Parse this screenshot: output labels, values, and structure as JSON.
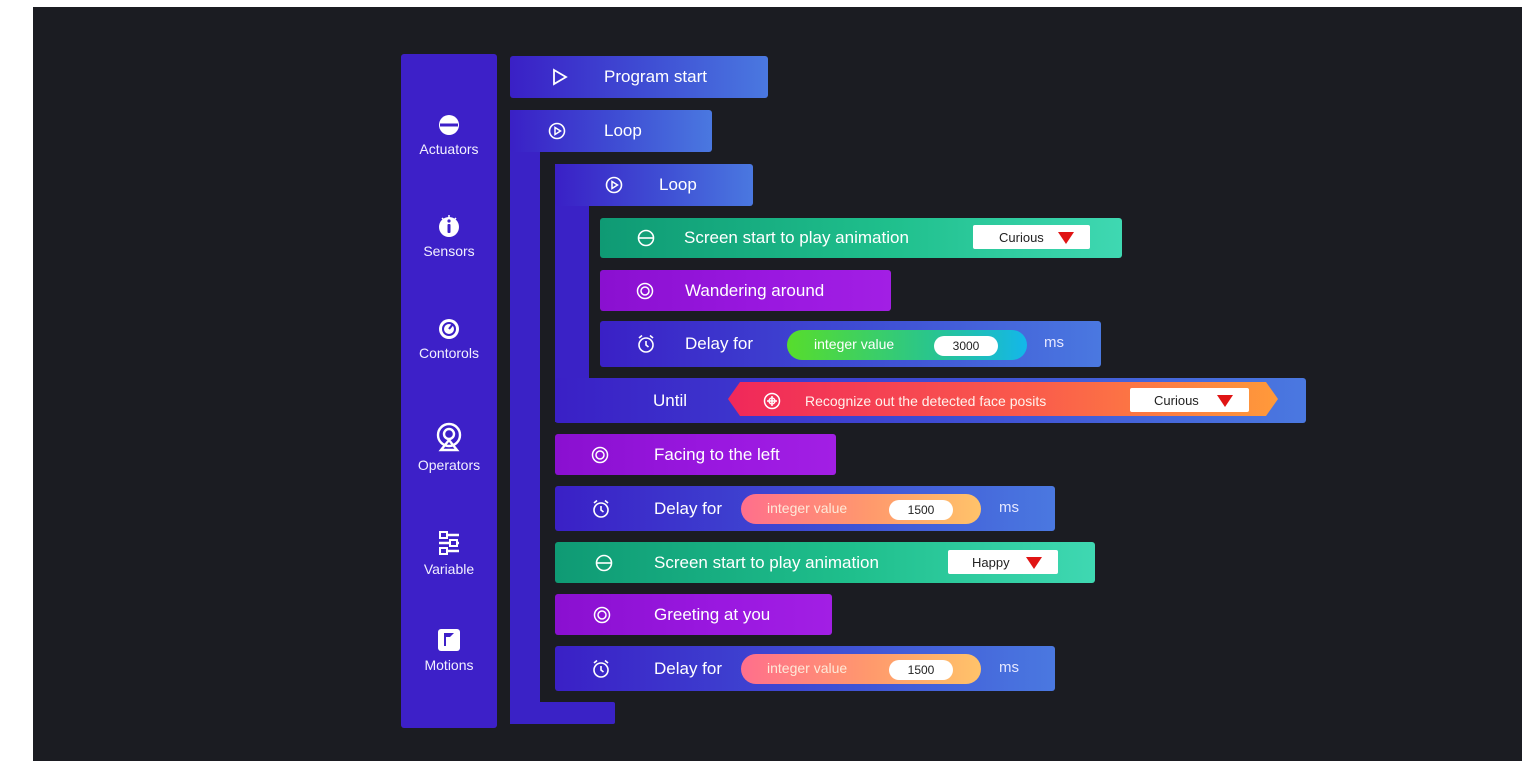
{
  "sidebar": {
    "categories": [
      {
        "label": "Actuators",
        "icon": "actuators-icon"
      },
      {
        "label": "Sensors",
        "icon": "sensors-icon"
      },
      {
        "label": "Contorols",
        "icon": "controls-icon"
      },
      {
        "label": "Operators",
        "icon": "operators-icon"
      },
      {
        "label": "Variable",
        "icon": "variable-icon"
      },
      {
        "label": "Motions",
        "icon": "motions-icon"
      }
    ]
  },
  "program": {
    "start_label": "Program start",
    "outer_loop_label": "Loop",
    "inner_loop_label": "Loop",
    "inner": {
      "animation_label": "Screen start to play animation",
      "animation_value": "Curious",
      "wander_label": "Wandering around",
      "delay_label": "Delay for",
      "delay_pill_label": "integer value",
      "delay_value": "3000",
      "delay_unit": "ms",
      "until_label": "Until",
      "condition_label": "Recognize out the detected face posits",
      "condition_value": "Curious"
    },
    "facing_label": "Facing to the left",
    "delay2_label": "Delay for",
    "delay2_pill_label": "integer value",
    "delay2_value": "1500",
    "delay2_unit": "ms",
    "animation2_label": "Screen start to play animation",
    "animation2_value": "Happy",
    "greeting_label": "Greeting at you",
    "delay3_label": "Delay for",
    "delay3_pill_label": "integer value",
    "delay3_value": "1500",
    "delay3_unit": "ms"
  },
  "colors": {
    "background": "#1b1c22",
    "sidebar": "#3d20c8",
    "dropdown_arrow": "#e01414",
    "condition_start": "#f0285a",
    "condition_end": "#ff9a3a"
  }
}
